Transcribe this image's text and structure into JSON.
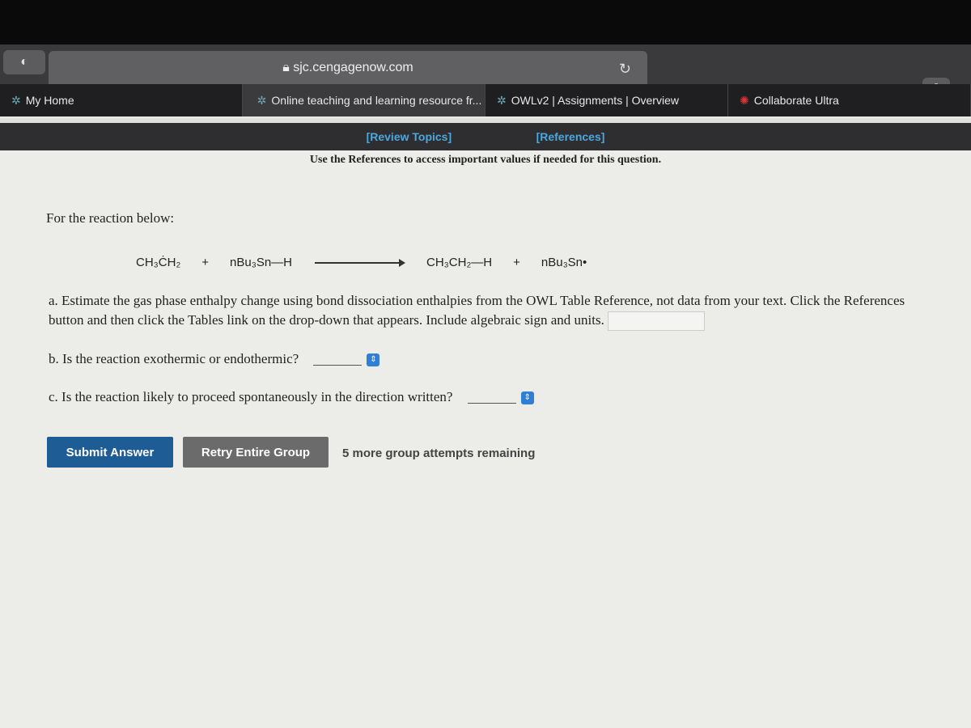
{
  "browser": {
    "url": "sjc.cengagenow.com",
    "tabs": [
      {
        "label": "My Home"
      },
      {
        "label": "Online teaching and learning resource fr..."
      },
      {
        "label": "OWLv2 | Assignments | Overview"
      },
      {
        "label": "Collaborate Ultra"
      }
    ]
  },
  "nav": {
    "review_topics": "[Review Topics]",
    "references": "[References]"
  },
  "note": "Use the References to access important values if needed for this question.",
  "intro": "For the reaction below:",
  "reaction": {
    "reactant1": "CH₃ĊH₂",
    "plus1": "+",
    "reactant2": "nBu₃Sn—H",
    "product1": "CH₃CH₂—H",
    "plus2": "+",
    "product2": "nBu₃Sn•"
  },
  "questions": {
    "a": "a. Estimate the gas phase enthalpy change using bond dissociation enthalpies from the OWL Table Reference, not data from your text. Click the References button and then click the Tables link on the drop-down that appears. Include algebraic sign and units.",
    "a_value": "",
    "b": "b. Is the reaction exothermic or endothermic?",
    "b_value": "",
    "c": "c. Is the reaction likely to proceed spontaneously in the direction written?",
    "c_value": ""
  },
  "buttons": {
    "submit": "Submit Answer",
    "retry": "Retry Entire Group"
  },
  "attempts": "5 more group attempts remaining"
}
